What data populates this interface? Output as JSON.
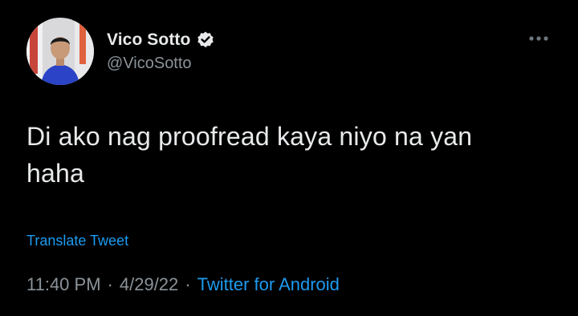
{
  "tweet": {
    "author": {
      "display_name": "Vico Sotto",
      "handle": "@VicoSotto",
      "verified": true,
      "avatar_icon": "profile-photo"
    },
    "text_line_1": "Di ako nag proofread kaya niyo na yan",
    "text_line_2": "haha",
    "translate_label": "Translate Tweet",
    "time": "11:40 PM",
    "date": "4/29/22",
    "separator": "·",
    "source": "Twitter for Android",
    "more_icon": "more-horizontal-icon"
  },
  "colors": {
    "background": "#000000",
    "primary_text": "#e7e9ea",
    "secondary_text": "#8b9399",
    "accent": "#1d9bf0",
    "verified_badge": "#e7e9ea"
  }
}
